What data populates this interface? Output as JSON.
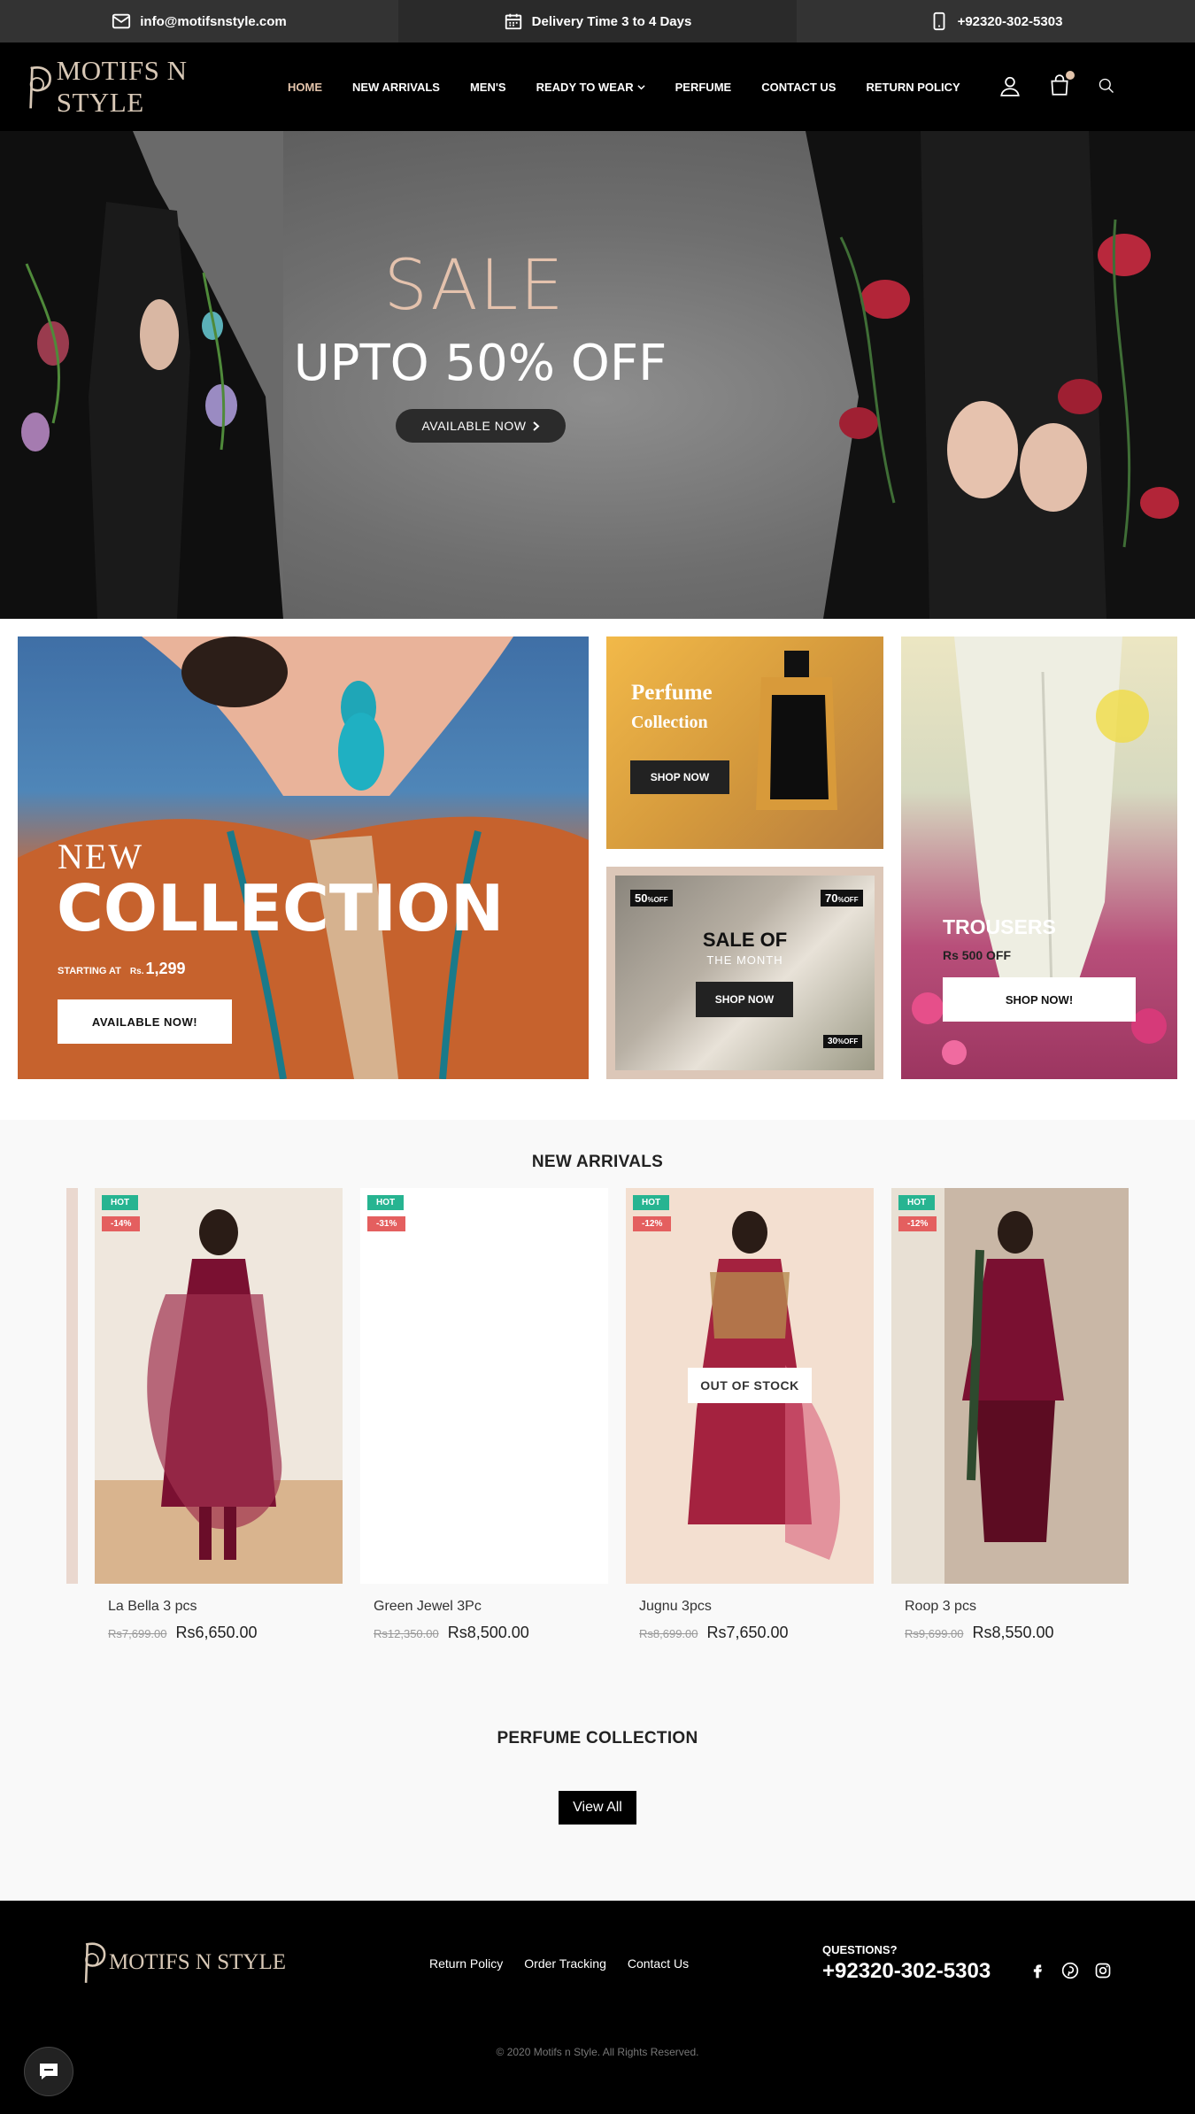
{
  "topbar": {
    "email": "info@motifsnstyle.com",
    "delivery": "Delivery Time 3 to 4 Days",
    "phone": "+92320-302-5303"
  },
  "header": {
    "logo_text": "MOTIFS N STYLE",
    "nav": [
      {
        "label": "HOME",
        "active": true
      },
      {
        "label": "NEW ARRIVALS"
      },
      {
        "label": "MEN'S"
      },
      {
        "label": "READY TO WEAR",
        "has_dropdown": true
      },
      {
        "label": "PERFUME"
      },
      {
        "label": "CONTACT US"
      },
      {
        "label": "RETURN POLICY"
      }
    ],
    "icons": [
      "user-icon",
      "cart-icon",
      "search-icon"
    ]
  },
  "hero": {
    "sale": "SALE",
    "offer": "UPTO 50% OFF",
    "button": "AVAILABLE NOW"
  },
  "banners": {
    "new_collection": {
      "new": "NEW",
      "collection": "COLLECTION",
      "starting": "STARTING AT",
      "currency": "Rs.",
      "price": "1,299",
      "button": "AVAILABLE NOW!"
    },
    "perfume": {
      "title": "Perfume",
      "subtitle": "Collection",
      "button": "SHOP NOW"
    },
    "sale_month": {
      "title": "SALE OF",
      "subtitle": "THE MONTH",
      "button": "SHOP NOW",
      "tags": [
        {
          "value": "50",
          "unit": "%OFF"
        },
        {
          "value": "70",
          "unit": "%OFF"
        },
        {
          "value": "30",
          "unit": "%OFF"
        }
      ]
    },
    "trousers": {
      "title": "TROUSERS",
      "subtitle": "Rs 500 OFF",
      "button": "SHOP NOW!"
    }
  },
  "new_arrivals": {
    "title": "NEW ARRIVALS",
    "products": [
      {
        "name": "La Bella 3 pcs",
        "old_price": "Rs7,699.00",
        "price": "Rs6,650.00",
        "badge": "HOT",
        "discount": "-14%",
        "out_of_stock": false
      },
      {
        "name": "Green Jewel 3Pc",
        "old_price": "Rs12,350.00",
        "price": "Rs8,500.00",
        "badge": "HOT",
        "discount": "-31%",
        "out_of_stock": false
      },
      {
        "name": "Jugnu 3pcs",
        "old_price": "Rs8,699.00",
        "price": "Rs7,650.00",
        "badge": "HOT",
        "discount": "-12%",
        "out_of_stock": true,
        "oos_label": "OUT OF STOCK"
      },
      {
        "name": "Roop 3 pcs",
        "old_price": "Rs9,699.00",
        "price": "Rs8,550.00",
        "badge": "HOT",
        "discount": "-12%",
        "out_of_stock": false
      }
    ]
  },
  "perfume_section": {
    "title": "PERFUME COLLECTION",
    "button": "View All"
  },
  "footer": {
    "logo_text": "MOTIFS N STYLE",
    "links": [
      "Return Policy",
      "Order Tracking",
      "Contact Us"
    ],
    "questions": "QUESTIONS?",
    "phone": "+92320-302-5303",
    "social": [
      "facebook-icon",
      "pinterest-icon",
      "instagram-icon"
    ],
    "copyright": "© 2020 Motifs n Style. All Rights Reserved."
  },
  "colors": {
    "accent": "#e3c4ab",
    "hot_badge": "#27b491",
    "discount_badge": "#e45f5f",
    "topbar": "#333333",
    "header": "#000000"
  }
}
